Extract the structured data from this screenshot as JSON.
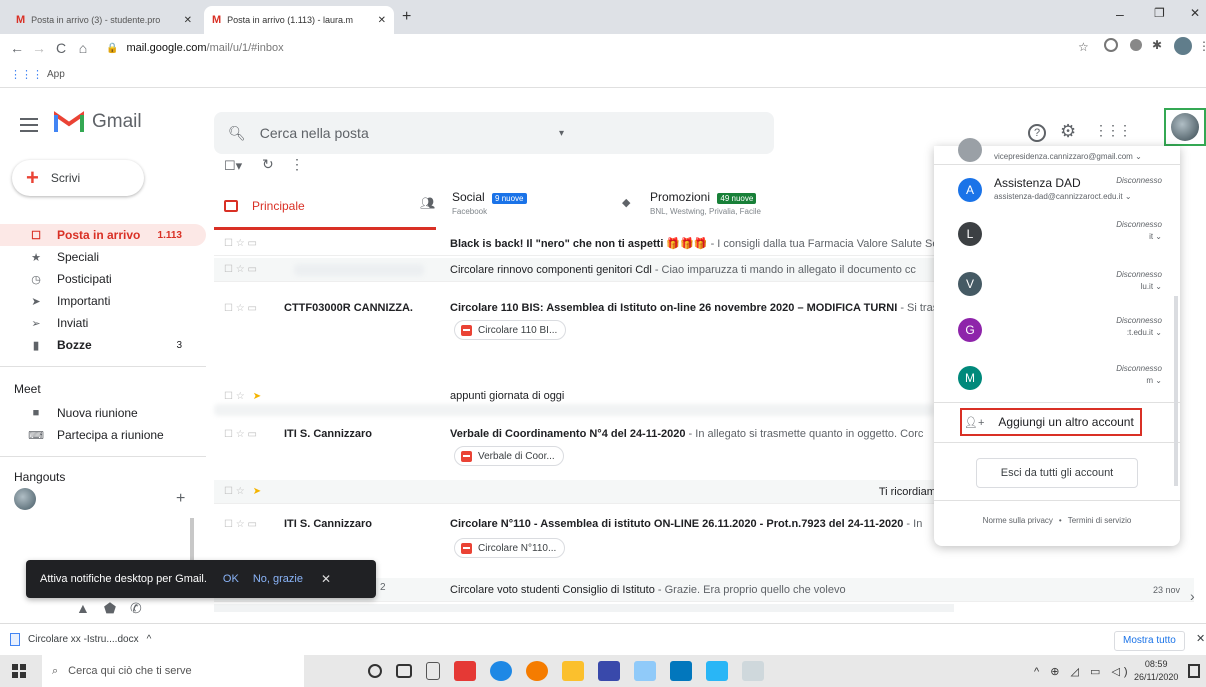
{
  "browser": {
    "tabs": [
      {
        "label": "Posta in arrivo (3) - studente.pro"
      },
      {
        "label": "Posta in arrivo (1.113) - laura.m"
      }
    ],
    "url_host": "mail.google.com",
    "url_path": "/mail/u/1/#inbox",
    "bookmarks_label": "App"
  },
  "gmail": {
    "logo_text": "Gmail",
    "search_placeholder": "Cerca nella posta",
    "compose_label": "Scrivi",
    "nav": [
      {
        "label": "Posta in arrivo",
        "count": "1.113"
      },
      {
        "label": "Speciali",
        "count": ""
      },
      {
        "label": "Posticipati",
        "count": ""
      },
      {
        "label": "Importanti",
        "count": ""
      },
      {
        "label": "Inviati",
        "count": ""
      },
      {
        "label": "Bozze",
        "count": "3"
      }
    ],
    "meet_header": "Meet",
    "meet_items": [
      "Nuova riunione",
      "Partecipa a riunione"
    ],
    "hangouts_header": "Hangouts",
    "tabs": {
      "primary": "Principale",
      "social": "Social",
      "social_badge": "9 nuove",
      "social_sub": "Facebook",
      "promo": "Promozioni",
      "promo_badge": "49 nuove",
      "promo_sub": "BNL, Westwing, Privalia, Facile"
    },
    "rows": [
      {
        "sender": "",
        "subject": "Black is back! Il \"nero\" che non ti aspetti 🎁🎁🎁",
        "snippet": " - I consigli dalla tua Farmacia Valore Salute Se"
      },
      {
        "sender": "",
        "subject": "Circolare rinnovo componenti genitori Cdl",
        "snippet": " - Ciao imparuzza ti mando in allegato il documento cc"
      },
      {
        "sender": "CTTF03000R CANNIZZA.",
        "subject": "Circolare 110 BIS: Assemblea di Istituto on-line 26 novembre 2020 – MODIFICA TURNI",
        "snippet": " - Si tras"
      },
      {
        "sender": "",
        "subject": "appunti giornata di oggi",
        "snippet": ""
      },
      {
        "sender": "ITI S. Cannizzaro",
        "subject": "Verbale di Coordinamento N°4 del 24-11-2020",
        "snippet": " - In allegato si trasmette quanto in oggetto. Corc"
      },
      {
        "sender": "",
        "subject": "",
        "snippet": "Ti ricordiamo"
      },
      {
        "sender": "ITI S. Cannizzaro",
        "subject": "Circolare N°110 - Assemblea di istituto ON-LINE 26.11.2020 - Prot.n.7923 del 24-11-2020",
        "snippet": " - In"
      },
      {
        "sender": "",
        "subject": "Circolare voto studenti Consiglio di Istituto",
        "snippet": " - Grazie. Era proprio quello che volevo",
        "date": "23 nov"
      }
    ],
    "attachments": [
      "Circolare 110 BI...",
      "Verbale di Coor...",
      "Circolare N°110..."
    ],
    "row_number_label": "2"
  },
  "account_panel": {
    "top_email": "vicepresidenza.cannizzaro@gmail.com",
    "accounts": [
      {
        "initial": "A",
        "name": "Assistenza DAD",
        "email": "assistenza-dad@cannizzaroct.edu.it",
        "status": "Disconnesso",
        "color": "#1a73e8"
      },
      {
        "initial": "L",
        "name": "",
        "email": "it",
        "status": "Disconnesso",
        "color": "#3c4043"
      },
      {
        "initial": "V",
        "name": "",
        "email": "lu.it",
        "status": "Disconnesso",
        "color": "#455a64"
      },
      {
        "initial": "G",
        "name": "",
        "email": ":t.edu.it",
        "status": "Disconnesso",
        "color": "#8e24aa"
      },
      {
        "initial": "M",
        "name": "",
        "email": "m",
        "status": "Disconnesso",
        "color": "#00897b"
      }
    ],
    "add_account": "Aggiungi un altro account",
    "sign_out_all": "Esci da tutti gli account",
    "privacy": "Norme sulla privacy",
    "terms": "Termini di servizio",
    "separator": "•"
  },
  "toast": {
    "text": "Attiva notifiche desktop per Gmail.",
    "ok": "OK",
    "no": "No, grazie"
  },
  "download_bar": {
    "file": "Circolare xx -Istru....docx",
    "show_all": "Mostra tutto"
  },
  "taskbar": {
    "search_placeholder": "Cerca qui ciò che ti serve",
    "time": "08:59",
    "date": "26/11/2020"
  }
}
